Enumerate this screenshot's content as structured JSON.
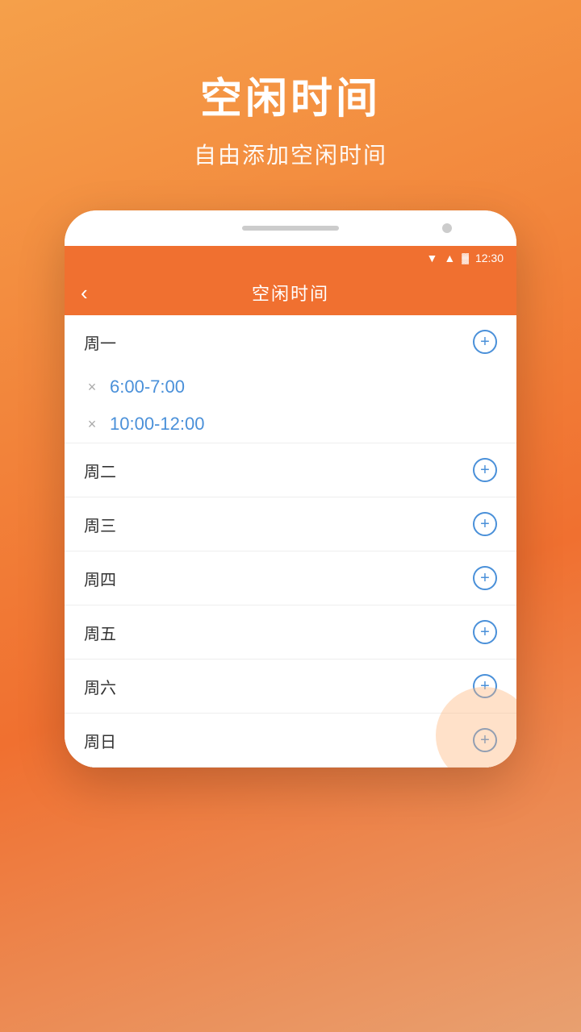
{
  "background": {
    "color_top": "#f5a04a",
    "color_bottom": "#f07030"
  },
  "header": {
    "main_title": "空闲时间",
    "sub_title": "自由添加空闲时间"
  },
  "status_bar": {
    "wifi_icon": "▼",
    "signal_icon": "▲",
    "battery_icon": "🔋",
    "time": "12:30"
  },
  "nav_bar": {
    "back_icon": "‹",
    "title": "空闲时间"
  },
  "days": [
    {
      "id": "monday",
      "label": "周一",
      "add_icon": "+",
      "time_slots": [
        {
          "range": "6:00-7:00"
        },
        {
          "range": "10:00-12:00"
        }
      ]
    },
    {
      "id": "tuesday",
      "label": "周二",
      "add_icon": "+",
      "time_slots": []
    },
    {
      "id": "wednesday",
      "label": "周三",
      "add_icon": "+",
      "time_slots": []
    },
    {
      "id": "thursday",
      "label": "周四",
      "add_icon": "+",
      "time_slots": []
    },
    {
      "id": "friday",
      "label": "周五",
      "add_icon": "+",
      "time_slots": []
    },
    {
      "id": "saturday",
      "label": "周六",
      "add_icon": "+",
      "time_slots": []
    },
    {
      "id": "sunday",
      "label": "周日",
      "add_icon": "+",
      "time_slots": []
    }
  ],
  "remove_icon": "×"
}
